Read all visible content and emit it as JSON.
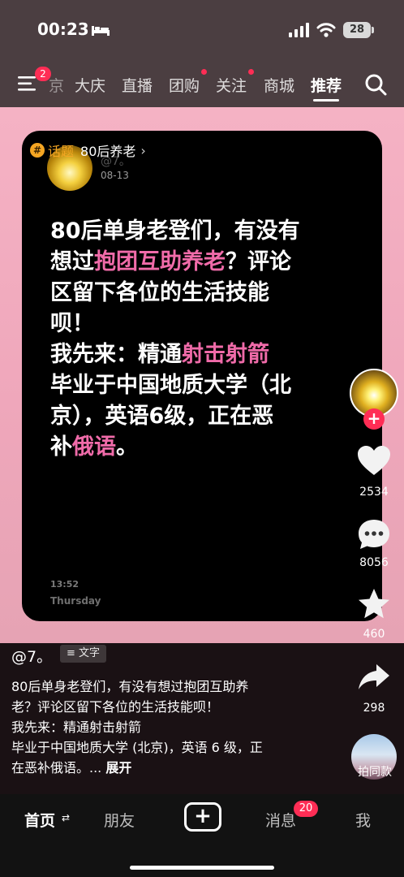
{
  "status_bar": {
    "time": "00:23",
    "battery": "28"
  },
  "nav": {
    "menu_badge": "2",
    "partial_item": "京",
    "items": [
      "大庆",
      "直播",
      "团购",
      "关注",
      "商城",
      "推荐"
    ],
    "active": "推荐"
  },
  "card": {
    "topic_icon": "#",
    "topic_label": "话题",
    "topic_name": "80后养老",
    "username": "@7。",
    "date": "08-13",
    "text_lines": [
      [
        "80后单身老登们，有没有"
      ],
      [
        "想过",
        "抱团互助养老",
        "？评论"
      ],
      [
        "区留下各位的生活技能"
      ],
      [
        "呗！"
      ],
      [
        "我先来：精通",
        "射击射箭"
      ],
      [
        "毕业于中国地质大学（北"
      ],
      [
        "京），英语6级，正在恶"
      ],
      [
        "补",
        "俄语",
        "。"
      ]
    ],
    "clock": "13:52",
    "day": "Thursday"
  },
  "side_actions": {
    "likes": "2534",
    "comments": "8056",
    "favorites": "460",
    "shares": "298",
    "bgm_label": "拍同款"
  },
  "post": {
    "author": "@7。",
    "type_label": "文字",
    "desc_lines": [
      "80后单身老登们，有没有想过抱团互助养",
      "老？评论区留下各位的生活技能呗！",
      "我先来：精通射击射箭",
      "毕业于中国地质大学 (北京)，英语 6 级，正",
      "在恶补俄语。..."
    ],
    "expand": "展开"
  },
  "tabbar": {
    "home": "首页",
    "friends": "朋友",
    "add_symbol": "+",
    "messages": "消息",
    "messages_badge": "20",
    "me": "我"
  },
  "colors": {
    "accent_pink": "#f06ba9",
    "badge_red": "#ff2d55",
    "topic_orange": "#f5a623"
  },
  "icons": [
    "bed-icon",
    "signal-icon",
    "wifi-icon",
    "menu-icon",
    "search-icon",
    "heart-icon",
    "comment-icon",
    "star-icon",
    "share-icon"
  ]
}
